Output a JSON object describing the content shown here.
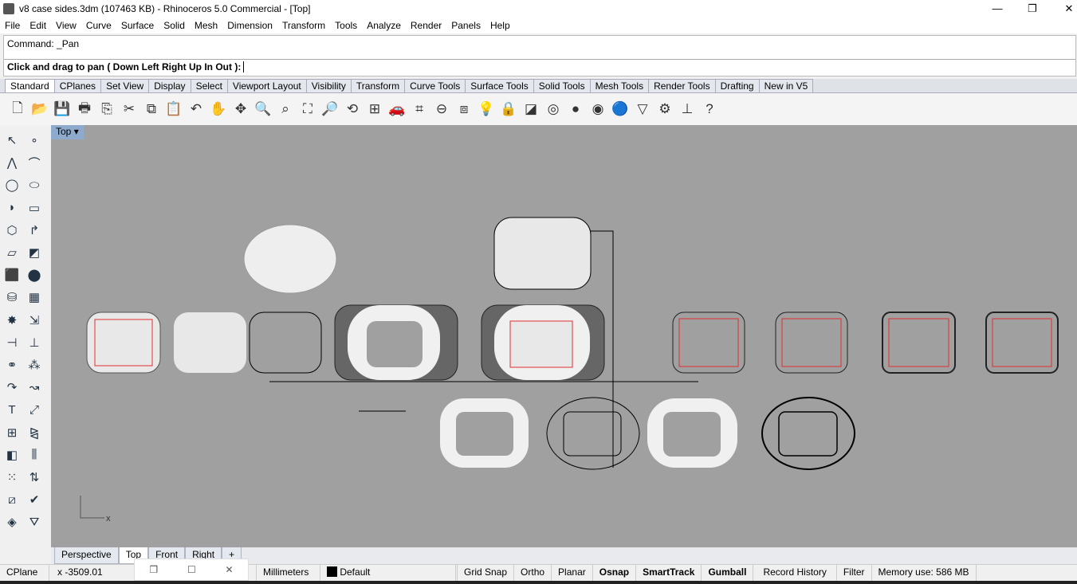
{
  "window": {
    "title": "v8 case sides.3dm (107463 KB) - Rhinoceros 5.0 Commercial - [Top]",
    "minimize": "—",
    "restore": "❐",
    "close": "✕"
  },
  "menu": [
    "File",
    "Edit",
    "View",
    "Curve",
    "Surface",
    "Solid",
    "Mesh",
    "Dimension",
    "Transform",
    "Tools",
    "Analyze",
    "Render",
    "Panels",
    "Help"
  ],
  "command": {
    "history": "Command: _Pan",
    "prompt": "Click and drag to pan ( Down  Left  Right  Up  In  Out ):"
  },
  "toolbar_tabs": [
    "Standard",
    "CPlanes",
    "Set View",
    "Display",
    "Select",
    "Viewport Layout",
    "Visibility",
    "Transform",
    "Curve Tools",
    "Surface Tools",
    "Solid Tools",
    "Mesh Tools",
    "Render Tools",
    "Drafting",
    "New in V5"
  ],
  "active_toolbar_tab": "Standard",
  "toolbar_icons": [
    {
      "name": "new-icon",
      "g": "🗋"
    },
    {
      "name": "open-icon",
      "g": "📂"
    },
    {
      "name": "save-icon",
      "g": "💾"
    },
    {
      "name": "print-icon",
      "g": "🖶"
    },
    {
      "name": "import-icon",
      "g": "⎘"
    },
    {
      "name": "cut-icon",
      "g": "✂"
    },
    {
      "name": "copy-icon",
      "g": "⧉"
    },
    {
      "name": "paste-icon",
      "g": "📋"
    },
    {
      "name": "undo-icon",
      "g": "↶"
    },
    {
      "name": "pan-hand-icon",
      "g": "✋"
    },
    {
      "name": "rotate-view-icon",
      "g": "✥"
    },
    {
      "name": "zoom-dynamic-icon",
      "g": "🔍"
    },
    {
      "name": "zoom-window-icon",
      "g": "⌕"
    },
    {
      "name": "zoom-extents-icon",
      "g": "⛶"
    },
    {
      "name": "zoom-selected-icon",
      "g": "🔎"
    },
    {
      "name": "undo-view-icon",
      "g": "⟲"
    },
    {
      "name": "four-viewports-icon",
      "g": "⊞"
    },
    {
      "name": "car-icon",
      "g": "🚗"
    },
    {
      "name": "cplane-icon",
      "g": "⌗"
    },
    {
      "name": "point-icon",
      "g": "⊖"
    },
    {
      "name": "osnap-icon",
      "g": "⧈"
    },
    {
      "name": "light-icon",
      "g": "💡"
    },
    {
      "name": "lock-icon",
      "g": "🔒"
    },
    {
      "name": "layer-icon",
      "g": "◪"
    },
    {
      "name": "color-wheel-icon",
      "g": "◎"
    },
    {
      "name": "shaded-sphere-icon",
      "g": "●"
    },
    {
      "name": "rendered-sphere-icon",
      "g": "◉"
    },
    {
      "name": "render-icon",
      "g": "🔵"
    },
    {
      "name": "analyze-icon",
      "g": "▽"
    },
    {
      "name": "options-gear-icon",
      "g": "⚙"
    },
    {
      "name": "dimension-icon",
      "g": "⊥"
    },
    {
      "name": "help-icon",
      "g": "?"
    }
  ],
  "left_icons": [
    {
      "name": "select-icon",
      "g": "↖"
    },
    {
      "name": "point-icon",
      "g": "∘"
    },
    {
      "name": "polyline-icon",
      "g": "⋀"
    },
    {
      "name": "curve-icon",
      "g": "⌒"
    },
    {
      "name": "circle-icon",
      "g": "◯"
    },
    {
      "name": "ellipse-icon",
      "g": "⬭"
    },
    {
      "name": "arc-icon",
      "g": "◗"
    },
    {
      "name": "rectangle-icon",
      "g": "▭"
    },
    {
      "name": "polygon-icon",
      "g": "⬡"
    },
    {
      "name": "fillet-curve-icon",
      "g": "↱"
    },
    {
      "name": "surface-icon",
      "g": "▱"
    },
    {
      "name": "extrude-icon",
      "g": "◩"
    },
    {
      "name": "box-icon",
      "g": "⬛"
    },
    {
      "name": "sphere-icon",
      "g": "⬤"
    },
    {
      "name": "cylinder-icon",
      "g": "⛁"
    },
    {
      "name": "mesh-icon",
      "g": "▦"
    },
    {
      "name": "explode-icon",
      "g": "✸"
    },
    {
      "name": "trim-icon",
      "g": "⇲"
    },
    {
      "name": "split-icon",
      "g": "⊣"
    },
    {
      "name": "join-icon",
      "g": "⊥"
    },
    {
      "name": "boolean-union-icon",
      "g": "⚭"
    },
    {
      "name": "boolean-diff-icon",
      "g": "⁂"
    },
    {
      "name": "fillet-icon",
      "g": "↷"
    },
    {
      "name": "chamfer-icon",
      "g": "↝"
    },
    {
      "name": "text-icon",
      "g": "T"
    },
    {
      "name": "scale-icon",
      "g": "⤢"
    },
    {
      "name": "array-icon",
      "g": "⊞"
    },
    {
      "name": "mirror-icon",
      "g": "⧎"
    },
    {
      "name": "solid-edit-icon",
      "g": "◧"
    },
    {
      "name": "hatch-icon",
      "g": "⫼"
    },
    {
      "name": "grid-array-icon",
      "g": "⁙"
    },
    {
      "name": "transform-icon",
      "g": "⇅"
    },
    {
      "name": "block-icon",
      "g": "⧄"
    },
    {
      "name": "check-icon",
      "g": "✔"
    },
    {
      "name": "shade-icon",
      "g": "◈"
    },
    {
      "name": "paint-icon",
      "g": "⛛"
    }
  ],
  "viewport": {
    "label": "Top",
    "axis_label": "x"
  },
  "viewport_tabs": [
    "Perspective",
    "Top",
    "Front",
    "Right"
  ],
  "active_viewport_tab": "Top",
  "add_tab": "+",
  "status": {
    "cplane": "CPlane",
    "x": "x -3509.01",
    "units": "Millimeters",
    "layer": "Default",
    "grid_snap": "Grid Snap",
    "ortho": "Ortho",
    "planar": "Planar",
    "osnap": "Osnap",
    "smarttrack": "SmartTrack",
    "gumball": "Gumball",
    "record_history": "Record History",
    "filter": "Filter",
    "memory": "Memory use: 586 MB"
  },
  "popup": {
    "restore": "❐",
    "maximize": "☐",
    "close": "✕"
  },
  "colors": {
    "viewport_bg": "#a0a0a0",
    "curve_red": "#e03030",
    "viewport_label": "#8eaacc"
  }
}
